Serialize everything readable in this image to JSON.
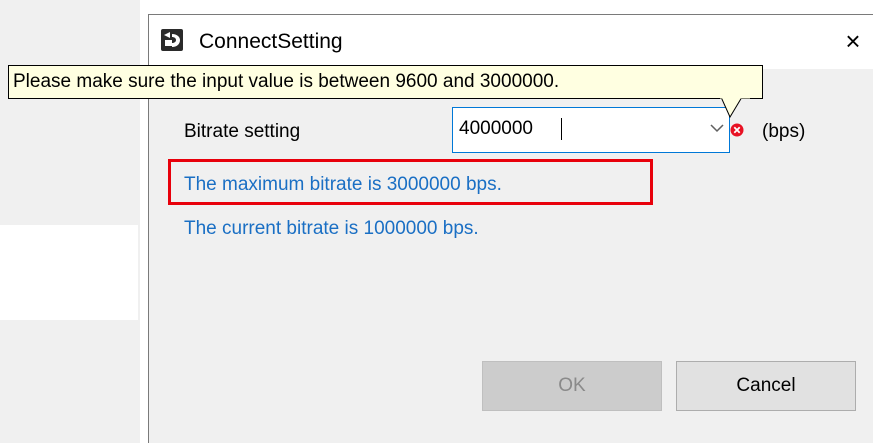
{
  "dialog": {
    "title": "ConnectSetting",
    "close_label": "×"
  },
  "tooltip": {
    "text": "Please make sure the input value is between 9600 and 3000000."
  },
  "bitrate": {
    "label": "Bitrate setting",
    "value": "4000000",
    "unit": "(bps)"
  },
  "info": {
    "max_text": "The maximum bitrate is 3000000 bps.",
    "current_text": "The current bitrate is 1000000 bps."
  },
  "buttons": {
    "ok_label": "OK",
    "cancel_label": "Cancel"
  },
  "colors": {
    "info_text": "#1a6fc4",
    "highlight": "#e8000b",
    "combo_focus_border": "#0078d7",
    "tooltip_bg": "#ffffe1"
  },
  "icons": {
    "app": "app-icon",
    "close": "close-icon",
    "dropdown": "chevron-down-icon",
    "error": "error-icon"
  }
}
